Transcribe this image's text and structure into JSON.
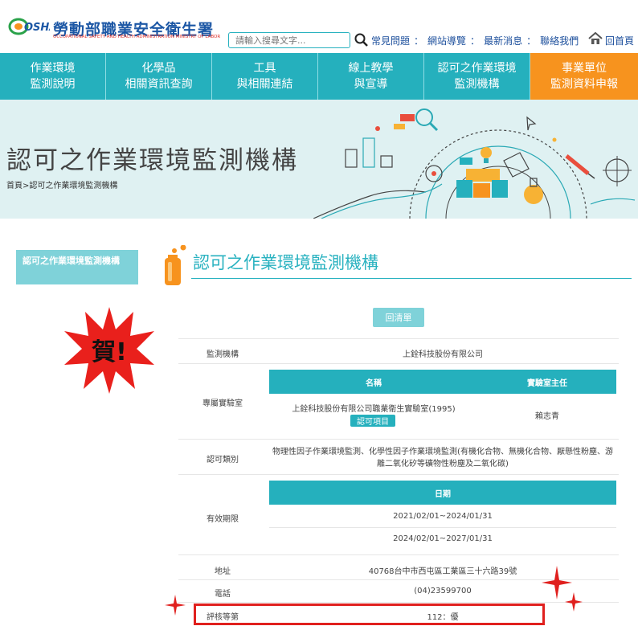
{
  "header": {
    "logo_text": "OSHA",
    "title": "勞動部職業安全衛生署",
    "subtitle": "OCCUPATIONAL SAFETY AND HEALTH ADMINISTRATION MINISTRY OF LABOR",
    "search_placeholder": "請輸入搜尋文字...",
    "links": [
      "常見問題",
      "網站導覽",
      "最新消息",
      "聯絡我們"
    ],
    "link_separator": "：",
    "home": "回首頁"
  },
  "nav": [
    {
      "line1": "作業環境",
      "line2": "監測說明"
    },
    {
      "line1": "化學品",
      "line2": "相關資訊查詢"
    },
    {
      "line1": "工具",
      "line2": "與相關連結"
    },
    {
      "line1": "線上教學",
      "line2": "與宣導"
    },
    {
      "line1": "認可之作業環境",
      "line2": "監測機構"
    },
    {
      "line1": "事業單位",
      "line2": "監測資料申報"
    }
  ],
  "banner": {
    "title": "認可之作業環境監測機構",
    "breadcrumb": "首頁>認可之作業環境監測機構"
  },
  "sidebar": {
    "item": "認可之作業環境監測機構"
  },
  "annotation": {
    "congrats": "賀!"
  },
  "main": {
    "title": "認可之作業環境監測機構",
    "back_button": "回清單",
    "rows": {
      "agency_label": "監測機構",
      "agency_value": "上銓科技股份有限公司",
      "lab_label": "專屬實驗室",
      "lab_col_name": "名稱",
      "lab_col_director": "實驗室主任",
      "lab_name": "上銓科技股份有限公司職業衛生實驗室(1995)",
      "lab_tag": "認可項目",
      "lab_director": "賴志青",
      "category_label": "認可類別",
      "category_value": "物理性因子作業環境監測、化學性因子作業環境監測(有機化合物、無機化合物、厭懸性粉塵、游離二氧化矽等礦物性粉塵及二氧化碳)",
      "period_label": "有效期限",
      "period_col": "日期",
      "period_1": "2021/02/01~2024/01/31",
      "period_2": "2024/02/01~2027/01/31",
      "address_label": "地址",
      "address_value": "40768台中市西屯區工業區三十六路39號",
      "phone_label": "電話",
      "phone_value": "(04)23599700",
      "rating_label": "評核等第",
      "rating_value": "112：優"
    }
  },
  "colors": {
    "teal": "#25b0bd",
    "light_teal": "#7fd2d9",
    "orange": "#f7931e",
    "highlight_red": "#e0201e",
    "brand_blue": "#1c57a5"
  }
}
